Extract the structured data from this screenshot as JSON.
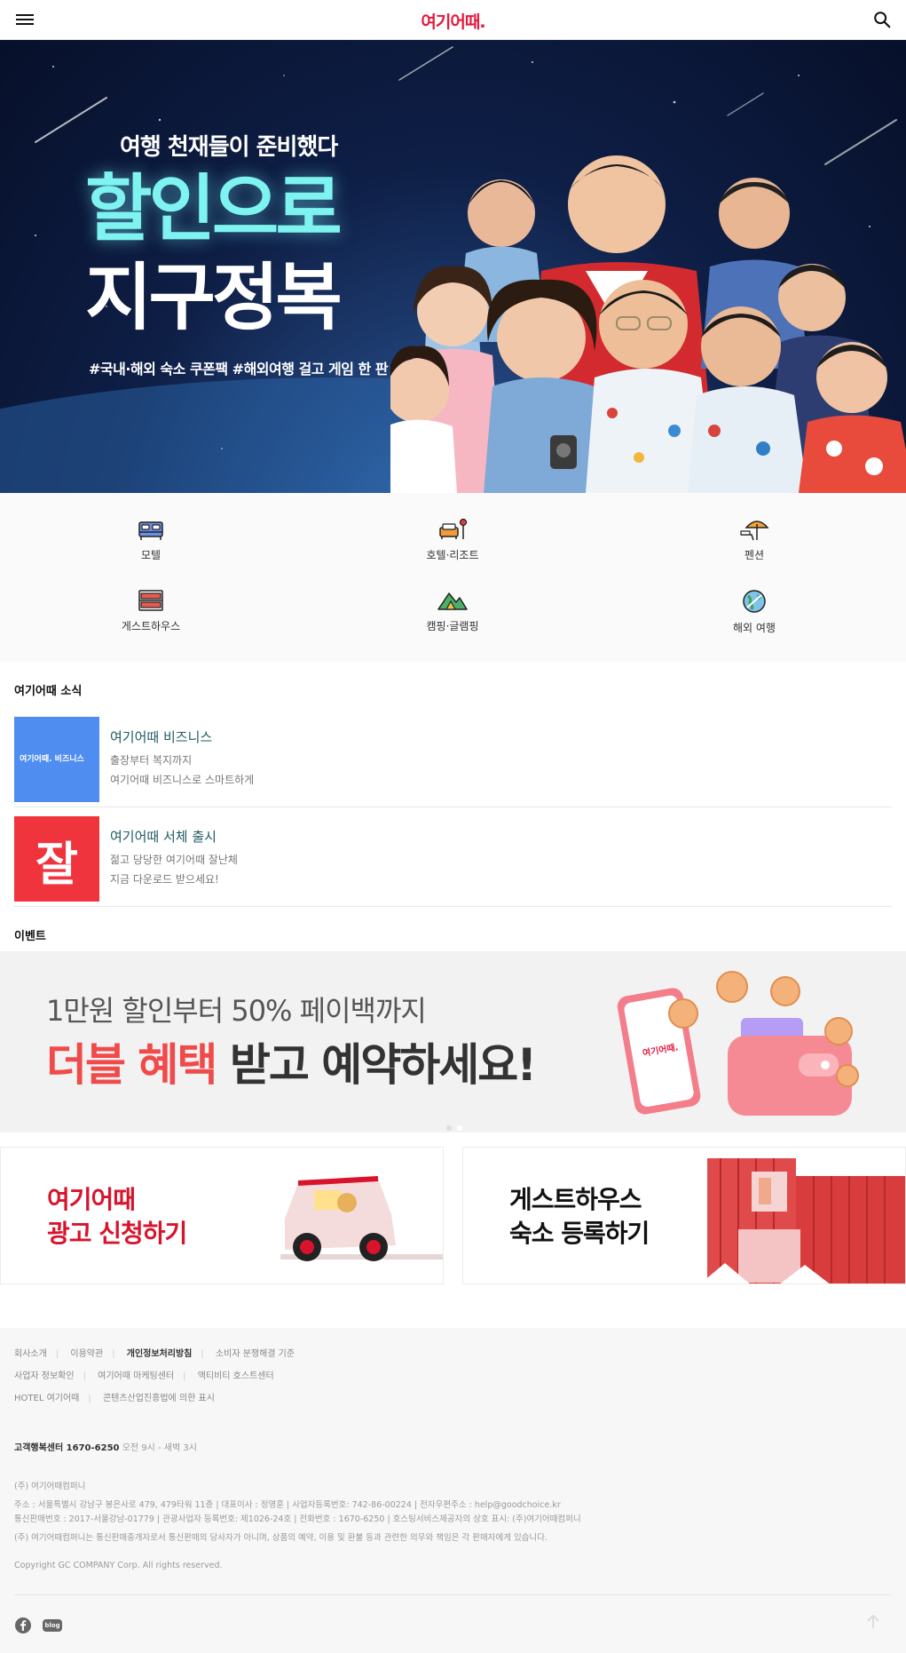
{
  "header": {
    "logo": "여기어때.",
    "menu_icon": "hamburger-menu-icon",
    "search_icon": "search-icon"
  },
  "hero": {
    "subtitle": "여행 천재들이 준비했다",
    "title_line1": "할인으로",
    "title_line2": "지구정복",
    "tags": "#국내·해외 숙소 쿠폰팩  #해외여행 걸고 게임 한 판"
  },
  "categories": [
    {
      "label": "모텔",
      "icon": "bed-icon"
    },
    {
      "label": "호텔·리조트",
      "icon": "sofa-lamp-icon"
    },
    {
      "label": "펜션",
      "icon": "beach-parasol-icon"
    },
    {
      "label": "게스트하우스",
      "icon": "bunk-bed-icon"
    },
    {
      "label": "캠핑·글램핑",
      "icon": "tent-mountain-icon"
    },
    {
      "label": "해외 여행",
      "icon": "globe-plane-icon"
    }
  ],
  "news": {
    "section_title": "여기어때 소식",
    "items": [
      {
        "title": "여기어때 비즈니스",
        "line1": "출장부터 복지까지",
        "line2": "여기어때 비즈니스로 스마트하게",
        "thumb_text": "여기어때. 비즈니스",
        "thumb_color": "#4f8ef0"
      },
      {
        "title": "여기어때 서체 출시",
        "line1": "젊고 당당한 여기어때 잘난체",
        "line2": "지금 다운로드 받으세요!",
        "thumb_text": "잘",
        "thumb_color": "#f0343d"
      }
    ]
  },
  "event": {
    "section_title": "이벤트",
    "banner_line1": "1만원 할인부터 50% 페이백까지",
    "banner_line2_red": "더블 혜택",
    "banner_line2_rest": " 받고 예약하세요!",
    "phone_logo": "여기어때."
  },
  "cards": [
    {
      "line1": "여기어때",
      "line2": "광고 신청하기",
      "color": "#d8142d"
    },
    {
      "line1": "게스트하우스",
      "line2": "숙소 등록하기",
      "color": "#111111"
    }
  ],
  "footer": {
    "links_row1": [
      "회사소개",
      "이용약관",
      "개인정보처리방침",
      "소비자 분쟁해결 기준"
    ],
    "links_row2": [
      "사업자 정보확인",
      "여기어때 마케팅센터",
      "액티비티 호스트센터"
    ],
    "links_row3": [
      "HOTEL 여기어때",
      "콘텐츠산업진흥법에 의한 표시"
    ],
    "phone_label": "고객행복센터 1670-6250",
    "phone_hours": "오전 9시 - 새벽 3시",
    "company": "(주) 여기어때컴퍼니",
    "address": "주소 : 서울특별시 강남구 봉은사로 479, 479타워 11층 | 대표이사 : 정명훈 | 사업자등록번호: 742-86-00224 | 전자우편주소 : help@goodchoice.kr",
    "license": "통신판매번호 : 2017-서울강남-01779 | 관광사업자 등록번호: 제1026-24호 | 전화번호 : 1670-6250 | 호스팅서비스제공자의 상호 표시: (주)여기어때컴퍼니",
    "disclaimer": "(주) 여기어때컴퍼니는 통신판매중개자로서 통신판매의 당사자가 아니며, 상품의 예약, 이용 및 환불 등과 관련한 의무와 책임은 각 판매자에게 있습니다.",
    "copyright": "Copyright GC COMPANY Corp. All rights reserved.",
    "blog_label": "blog",
    "facebook_icon": "facebook-icon",
    "top_icon": "arrow-up-icon"
  }
}
